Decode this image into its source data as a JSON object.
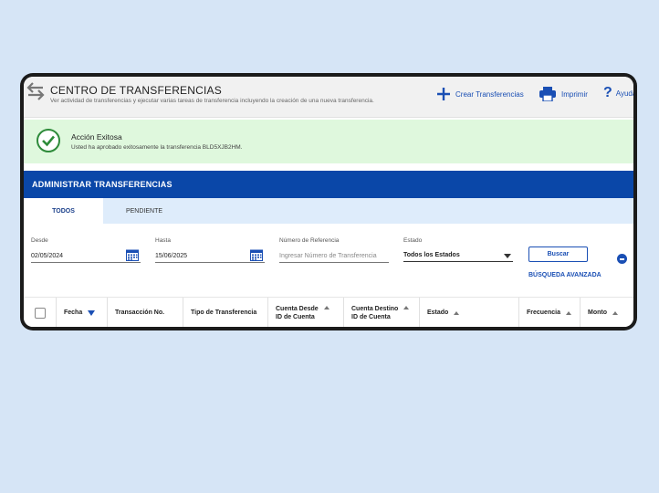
{
  "header": {
    "title": "CENTRO DE TRANSFERENCIAS",
    "subtitle": "Ver actividad de transferencias y ejecutar varias tareas de transferencia incluyendo la creación de una nueva transferencia.",
    "actions": {
      "create": "Crear Transferencias",
      "print": "Imprimir",
      "help": "Ayuda"
    }
  },
  "alert": {
    "title": "Acción Exitosa",
    "message": "Usted ha aprobado exitosamente la transferencia BLD5XJB2HM."
  },
  "section": {
    "title": "ADMINISTRAR TRANSFERENCIAS"
  },
  "tabs": [
    {
      "label": "TODOS",
      "active": true
    },
    {
      "label": "PENDIENTE",
      "active": false
    }
  ],
  "filters": {
    "desde": {
      "label": "Desde",
      "value": "02/05/2024"
    },
    "hasta": {
      "label": "Hasta",
      "value": "15/06/2025"
    },
    "referencia": {
      "label": "Número de Referencia",
      "placeholder": "Ingresar Número de Transferencia"
    },
    "estado": {
      "label": "Estado",
      "value": "Todos los Estados"
    },
    "search_button": "Buscar",
    "advanced_link": "BÚSQUEDA AVANZADA"
  },
  "table": {
    "columns": [
      {
        "label": "Fecha",
        "sort": "desc-active"
      },
      {
        "label": "Transacción No."
      },
      {
        "label": "Tipo de Transferencia"
      },
      {
        "label": "Cuenta Desde",
        "label2": "ID de Cuenta",
        "sort": "asc"
      },
      {
        "label": "Cuenta Destino",
        "label2": "ID de Cuenta",
        "sort": "asc"
      },
      {
        "label": "Estado",
        "sort": "asc"
      },
      {
        "label": "Frecuencia",
        "sort": "asc"
      },
      {
        "label": "Monto",
        "sort": "asc"
      }
    ]
  },
  "colors": {
    "page_bg": "#d6e5f6",
    "primary": "#0a47a8",
    "link": "#1a4fb4",
    "success_bg": "#dff8dd",
    "success_icon": "#2e8b3a"
  },
  "icons": [
    "transfer-arrows-icon",
    "plus-icon",
    "printer-icon",
    "help-icon",
    "check-circle-icon",
    "calendar-icon",
    "dropdown-arrow-icon",
    "collapse-minus-icon",
    "sort-arrow-icon"
  ]
}
